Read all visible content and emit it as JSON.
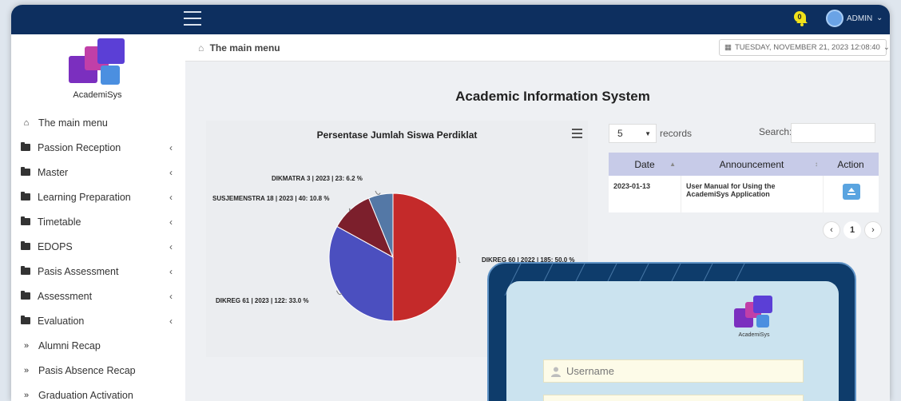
{
  "topbar": {
    "notification_count": "0",
    "admin_label": "ADMIN",
    "admin_caret": "⌄"
  },
  "sidebar": {
    "logo_text": "AcademiSys",
    "items": [
      {
        "label": "The main menu",
        "icon": "home-icon",
        "has_caret": false
      },
      {
        "label": "Passion Reception",
        "icon": "folder-icon",
        "has_caret": true
      },
      {
        "label": "Master",
        "icon": "folder-icon",
        "has_caret": true
      },
      {
        "label": "Learning Preparation",
        "icon": "folder-icon",
        "has_caret": true
      },
      {
        "label": "Timetable",
        "icon": "folder-icon",
        "has_caret": true
      },
      {
        "label": "EDOPS",
        "icon": "folder-icon",
        "has_caret": true
      },
      {
        "label": "Pasis Assessment",
        "icon": "folder-icon",
        "has_caret": true
      },
      {
        "label": "Assessment",
        "icon": "folder-icon",
        "has_caret": true
      },
      {
        "label": "Evaluation",
        "icon": "folder-icon",
        "has_caret": true
      },
      {
        "label": "Alumni Recap",
        "icon": "double-chevron-icon",
        "has_caret": false
      },
      {
        "label": "Pasis Absence Recap",
        "icon": "double-chevron-icon",
        "has_caret": false
      },
      {
        "label": "Graduation Activation",
        "icon": "double-chevron-icon",
        "has_caret": false
      }
    ],
    "caret_glyph": "‹"
  },
  "breadcrumb": {
    "label": "The main menu"
  },
  "datetime": {
    "text": "TUESDAY, NOVEMBER 21, 2023 12:08:40"
  },
  "page_title": "Academic Information System",
  "chart_data": {
    "type": "pie",
    "title": "Persentase Jumlah Siswa Perdiklat",
    "slices": [
      {
        "label": "DIKREG 60 | 2022 | 185: 50.0 %",
        "value": 50.0,
        "color": "#c42a2a"
      },
      {
        "label": "DIKREG 61 | 2023 | 122: 33.0 %",
        "value": 33.0,
        "color": "#4b4fbf"
      },
      {
        "label": "SUSJEMENSTRA 18 | 2023 | 40: 10.8 %",
        "value": 10.8,
        "color": "#7c1f2c"
      },
      {
        "label": "DIKMATRA 3 | 2023 | 23: 6.2 %",
        "value": 6.2,
        "color": "#5478a6"
      }
    ]
  },
  "table_controls": {
    "page_size": "5",
    "records_label": "records",
    "search_label": "Search:"
  },
  "table": {
    "headers": [
      "Date",
      "Announcement",
      "Action"
    ],
    "rows": [
      {
        "date": "2023-01-13",
        "announcement": "User Manual for Using the AcademiSys Application"
      }
    ]
  },
  "pagination": {
    "prev": "‹",
    "current": "1",
    "next": "›"
  },
  "login": {
    "logo_text": "AcademiSys",
    "username_placeholder": "Username"
  }
}
